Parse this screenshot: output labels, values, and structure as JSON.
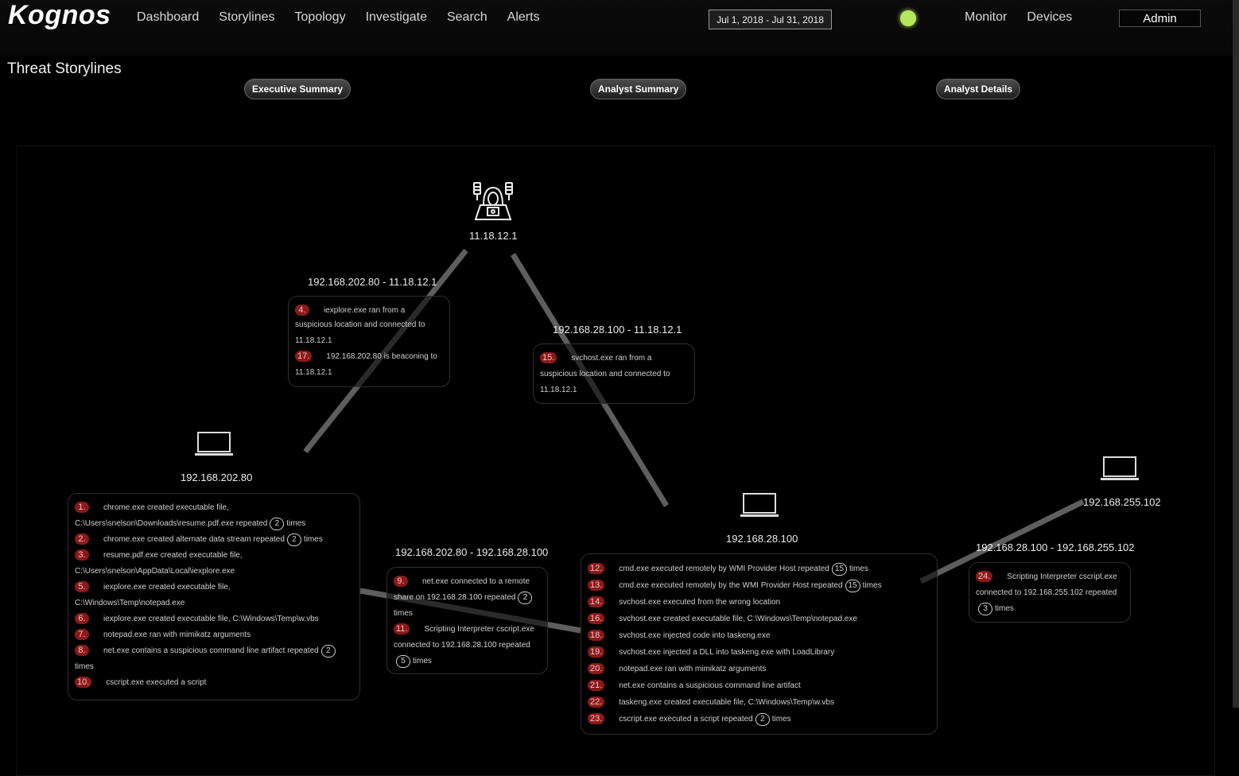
{
  "app": {
    "logo": "Kognos"
  },
  "nav": {
    "left": [
      "Dashboard",
      "Storylines",
      "Topology",
      "Investigate",
      "Search",
      "Alerts"
    ],
    "right": [
      "Monitor",
      "Devices"
    ],
    "date_range": "Jul 1, 2018 - Jul 31, 2018",
    "status_color": "#b4e75d",
    "user": "Admin"
  },
  "page": {
    "title": "Threat Storylines",
    "views": [
      "Executive Summary",
      "Analyst Summary",
      "Analyst Details"
    ]
  },
  "nodes": {
    "attacker": {
      "ip": "11.18.12.1",
      "icon": "hacker-icon"
    },
    "host_a": {
      "ip": "192.168.202.80",
      "icon": "laptop-icon"
    },
    "host_b": {
      "ip": "192.168.28.100",
      "icon": "laptop-icon"
    },
    "host_c": {
      "ip": "192.168.255.102",
      "icon": "laptop-icon"
    }
  },
  "edges": {
    "a_attacker": "192.168.202.80 - 11.18.12.1",
    "b_attacker": "192.168.28.100 - 11.18.12.1",
    "a_b": "192.168.202.80 - 192.168.28.100",
    "b_c": "192.168.28.100 - 192.168.255.102"
  },
  "events": {
    "edge_a_attacker": [
      {
        "n": "4.",
        "pre": "iexplore.exe ran from a",
        "rest": "suspicious location and connected to 11.18.12.1"
      },
      {
        "n": "17.",
        "pre": "192.168.202.80 is beaconing to",
        "rest": "11.18.12.1"
      }
    ],
    "edge_b_attacker": [
      {
        "n": "15.",
        "pre": "svchost.exe ran from a",
        "rest": "suspicious location and connected to 11.18.12.1"
      }
    ],
    "host_a": [
      {
        "n": "1.",
        "t1": "chrome.exe created executable file,",
        "t2": "C:\\Users\\snelson\\Downloads\\resume.pdf.exe repeated",
        "c": "2",
        "t3": "times"
      },
      {
        "n": "2.",
        "t1": "chrome.exe created alternate data stream repeated",
        "c": "2",
        "t3": "times"
      },
      {
        "n": "3.",
        "t1": "resume.pdf.exe created executable file,",
        "t2": "C:\\Users\\snelson\\AppData\\Local\\iexplore.exe"
      },
      {
        "n": "5.",
        "t1": "iexplore.exe created executable file,",
        "t2": "C:\\Windows\\Temp\\notepad.exe"
      },
      {
        "n": "6.",
        "t1": "iexplore.exe created executable file, C:\\Windows\\Temp\\w.vbs"
      },
      {
        "n": "7.",
        "t1": "notepad.exe ran with mimikatz arguments"
      },
      {
        "n": "8.",
        "t1": "net.exe contains a suspicious command line artifact repeated",
        "c": "2",
        "t4": "times"
      },
      {
        "n": "10.",
        "t1": "cscript.exe executed a script"
      }
    ],
    "edge_a_b": [
      {
        "n": "9.",
        "t1": "net.exe connected to a remote",
        "t2": "share on 192.168.28.100 repeated",
        "c": "2",
        "t4": "times"
      },
      {
        "n": "11.",
        "t1": "Scripting Interpreter cscript.exe",
        "t2": "connected to 192.168.28.100 repeated",
        "c": "5",
        "t3": "times"
      }
    ],
    "host_b": [
      {
        "n": "12.",
        "t1": "cmd.exe executed remotely by WMI Provider Host repeated",
        "c": "15",
        "t3": "times"
      },
      {
        "n": "13.",
        "t1": "cmd.exe executed remotely by the WMI Provider Host repeated",
        "c": "15",
        "t3": "times"
      },
      {
        "n": "14.",
        "t1": "svchost.exe executed from the wrong location"
      },
      {
        "n": "16.",
        "t1": "svchost.exe created executable file, C:\\Windows\\Temp\\notepad.exe"
      },
      {
        "n": "18.",
        "t1": "svchost.exe injected code into taskeng.exe"
      },
      {
        "n": "19.",
        "t1": "svchost.exe injected a DLL into taskeng.exe with LoadLibrary"
      },
      {
        "n": "20.",
        "t1": "notepad.exe ran with mimikatz arguments"
      },
      {
        "n": "21.",
        "t1": "net.exe contains a suspicious command line artifact"
      },
      {
        "n": "22.",
        "t1": "taskeng.exe created executable file, C:\\Windows\\Temp\\w.vbs"
      },
      {
        "n": "23.",
        "t1": "cscript.exe executed a script repeated",
        "c": "2",
        "t3": "times"
      }
    ],
    "edge_b_c": [
      {
        "n": "24.",
        "t1": "Scripting Interpreter cscript.exe",
        "t2": "connected to 192.168.255.102 repeated",
        "c": "3",
        "t3": "times"
      }
    ]
  },
  "colors": {
    "accent_num": "#8a1a1a",
    "link": "#5e5e5e"
  }
}
